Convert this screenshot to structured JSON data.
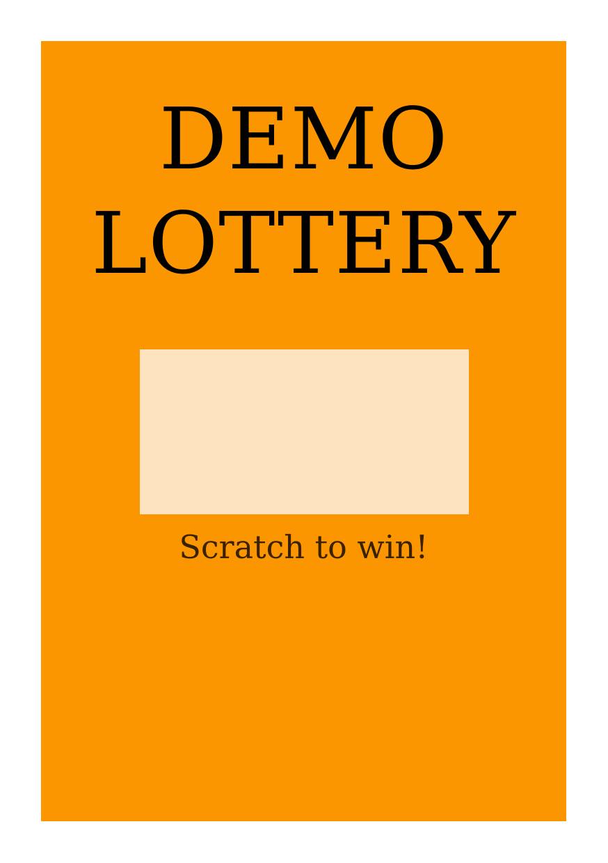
{
  "ticket": {
    "title_line1": "DEMO",
    "title_line2": "LOTTERY",
    "caption": "Scratch to win!"
  },
  "colors": {
    "background": "#ffffff",
    "ticket": "#fb9600",
    "scratch_area": "#fde3bf",
    "text": "#000000"
  }
}
